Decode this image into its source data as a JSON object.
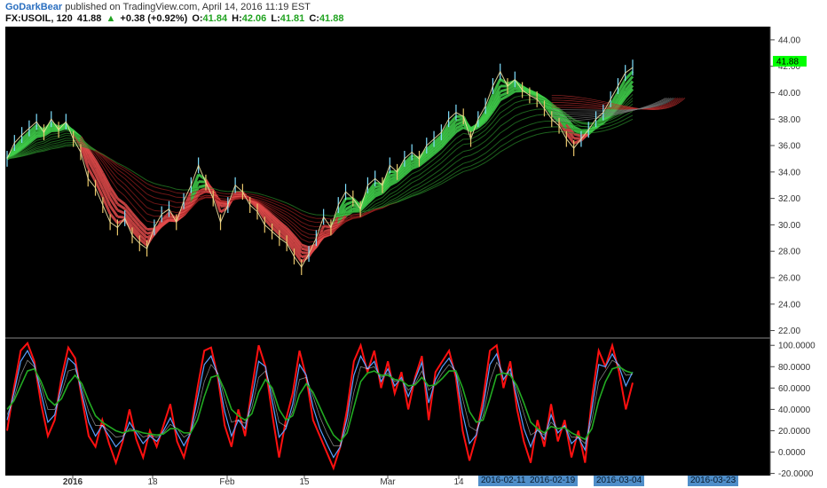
{
  "header": {
    "author": "GoDarkBear",
    "published": "published on TradingView.com, April 14, 2016 11:19 EST",
    "symbol": "FX:USOIL, 120",
    "last": "41.88",
    "change_arrow": "▲",
    "change": "+0.38 (+0.92%)",
    "open_label": "O:",
    "open": "41.84",
    "high_label": "H:",
    "high": "42.06",
    "low_label": "L:",
    "low": "41.81",
    "close_label": "C:",
    "close": "41.88"
  },
  "colors": {
    "background": "#000000",
    "up": "#21a321",
    "price_tag": "#00ff00",
    "stoch_fast": "#ff1010",
    "stoch_k": "#5aa0ff",
    "stoch_d": "#22aa22",
    "date_tag": "#4f8ec9"
  },
  "price_tag": "41.88",
  "date_tags": [
    "2016-02-11",
    "2016-02-19",
    "2016-03-04",
    "2016-03-23"
  ],
  "chart_data": [
    {
      "type": "line",
      "title": "FX:USOIL, 120",
      "ylim": [
        21.5,
        45.0
      ],
      "y_ticks": [
        "44.00",
        "42.00",
        "40.00",
        "38.00",
        "36.00",
        "34.00",
        "32.00",
        "30.00",
        "28.00",
        "26.00",
        "24.00",
        "22.00"
      ],
      "x_ticks": [
        "2016",
        "18",
        "Feb",
        "15",
        "Mar",
        "14"
      ],
      "series": [
        {
          "values": [
            35.0,
            36.2,
            36.8,
            37.3,
            37.8,
            37.0,
            38.0,
            37.2,
            37.8,
            36.5,
            35.5,
            33.5,
            32.8,
            31.5,
            30.2,
            29.8,
            30.5,
            29.2,
            28.6,
            28.2,
            29.8,
            30.8,
            31.2,
            30.2,
            31.8,
            33.0,
            34.5,
            33.2,
            32.0,
            30.2,
            31.5,
            33.0,
            32.5,
            31.5,
            31.0,
            30.0,
            29.5,
            29.0,
            28.6,
            27.6,
            26.8,
            27.8,
            29.0,
            30.6,
            29.8,
            31.5,
            32.5,
            32.0,
            31.2,
            33.0,
            33.5,
            33.0,
            34.5,
            34.0,
            35.0,
            35.5,
            35.0,
            36.0,
            36.5,
            37.0,
            38.0,
            38.5,
            38.2,
            36.5,
            38.0,
            39.0,
            40.5,
            41.6,
            40.5,
            41.0,
            40.2,
            39.8,
            39.5,
            38.8,
            38.0,
            37.5,
            36.5,
            35.8,
            36.5,
            37.2,
            38.0,
            38.5,
            39.5,
            40.5,
            41.5,
            41.9
          ]
        }
      ]
    },
    {
      "type": "line",
      "ylim": [
        -22,
        106
      ],
      "y_ticks": [
        "100.0000",
        "80.0000",
        "60.0000",
        "40.0000",
        "20.0000",
        "0.0000",
        "-20.0000"
      ],
      "series": [
        {
          "values": [
            20,
            60,
            95,
            102,
            85,
            45,
            15,
            30,
            70,
            98,
            88,
            50,
            15,
            5,
            30,
            8,
            -10,
            10,
            40,
            12,
            -5,
            20,
            5,
            25,
            45,
            10,
            -5,
            20,
            60,
            95,
            98,
            70,
            25,
            5,
            40,
            15,
            60,
            100,
            80,
            35,
            -5,
            30,
            55,
            95,
            70,
            30,
            15,
            0,
            -15,
            5,
            40,
            85,
            100,
            75,
            95,
            60,
            85,
            55,
            75,
            40,
            70,
            90,
            30,
            75,
            85,
            95,
            70,
            20,
            -8,
            15,
            50,
            95,
            100,
            60,
            85,
            40,
            10,
            -10,
            30,
            5,
            45,
            10,
            30,
            -5,
            20,
            -10,
            50,
            95,
            80,
            100,
            75,
            40,
            65
          ]
        },
        {
          "values": [
            30,
            55,
            85,
            95,
            82,
            55,
            28,
            35,
            62,
            88,
            82,
            55,
            28,
            15,
            25,
            15,
            5,
            12,
            28,
            18,
            8,
            15,
            10,
            20,
            32,
            18,
            6,
            18,
            50,
            82,
            90,
            72,
            38,
            15,
            30,
            22,
            50,
            85,
            80,
            48,
            14,
            22,
            45,
            82,
            72,
            42,
            22,
            8,
            -5,
            5,
            32,
            72,
            90,
            78,
            85,
            66,
            78,
            62,
            70,
            52,
            68,
            84,
            46,
            68,
            80,
            88,
            74,
            36,
            8,
            16,
            42,
            82,
            92,
            68,
            78,
            50,
            22,
            5,
            22,
            12,
            35,
            18,
            25,
            8,
            14,
            2,
            40,
            82,
            80,
            92,
            80,
            62,
            75
          ]
        },
        {
          "values": [
            35,
            50,
            72,
            86,
            80,
            62,
            40,
            40,
            55,
            76,
            78,
            60,
            38,
            25,
            25,
            20,
            14,
            15,
            22,
            20,
            14,
            16,
            14,
            18,
            26,
            22,
            14,
            18,
            38,
            66,
            82,
            74,
            50,
            28,
            30,
            27,
            42,
            70,
            76,
            56,
            28,
            24,
            38,
            68,
            70,
            52,
            33,
            18,
            6,
            6,
            24,
            56,
            80,
            78,
            80,
            70,
            74,
            66,
            68,
            58,
            64,
            76,
            58,
            64,
            74,
            82,
            76,
            50,
            24,
            20,
            34,
            66,
            84,
            74,
            74,
            58,
            36,
            16,
            20,
            16,
            28,
            22,
            24,
            14,
            14,
            8,
            30,
            66,
            76,
            86,
            82,
            72,
            73
          ]
        },
        {
          "values": [
            40,
            48,
            62,
            76,
            78,
            66,
            50,
            44,
            50,
            64,
            72,
            64,
            48,
            34,
            28,
            24,
            20,
            18,
            20,
            20,
            18,
            17,
            16,
            17,
            22,
            22,
            18,
            18,
            30,
            52,
            70,
            72,
            58,
            40,
            34,
            30,
            36,
            56,
            68,
            60,
            40,
            30,
            34,
            54,
            64,
            56,
            42,
            28,
            16,
            10,
            18,
            42,
            66,
            74,
            76,
            72,
            72,
            68,
            67,
            62,
            63,
            70,
            62,
            63,
            69,
            76,
            76,
            60,
            38,
            28,
            30,
            50,
            72,
            74,
            72,
            62,
            46,
            28,
            22,
            18,
            24,
            22,
            23,
            18,
            15,
            12,
            22,
            48,
            66,
            78,
            80,
            76,
            74
          ]
        }
      ]
    }
  ]
}
